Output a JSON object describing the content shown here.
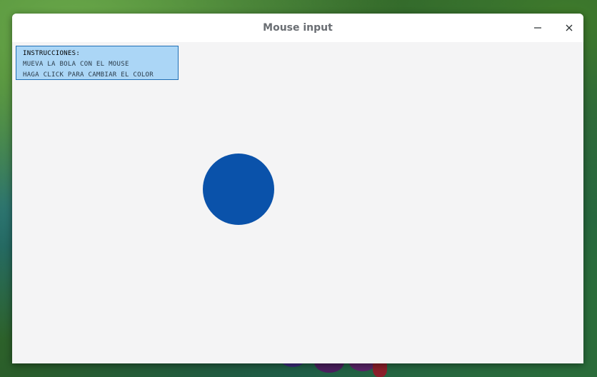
{
  "window": {
    "title": "Mouse input",
    "controls": {
      "minimize_icon": "minimize-icon",
      "close_icon": "close-icon"
    }
  },
  "instructions": {
    "heading": "INSTRUCCIONES:",
    "lines": [
      "MUEVA LA BOLA CON EL MOUSE",
      "HAGA CLICK PARA CAMBIAR EL COLOR"
    ]
  },
  "colors": {
    "ball": "#0a52aa",
    "canvas_background": "#f4f4f5",
    "instructions_background": "#abd6f6",
    "instructions_border": "#1f6fb5"
  }
}
